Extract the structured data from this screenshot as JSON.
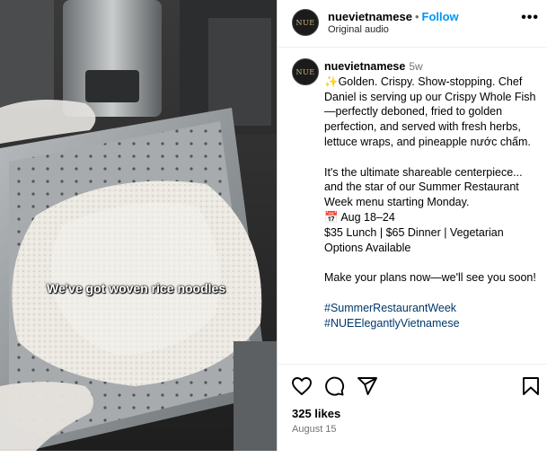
{
  "header": {
    "avatar_text": "NUE",
    "username": "nuevietnamese",
    "separator": "•",
    "follow_label": "Follow",
    "audio_label": "Original audio",
    "more_label": "•••"
  },
  "video": {
    "caption": "We've got woven rice noodles"
  },
  "post": {
    "author": "nuevietnamese",
    "time": "5w",
    "line1": "✨Golden. Crispy. Show-stopping. Chef Daniel is serving up our Crispy Whole Fish—perfectly deboned, fried to golden perfection, and served with fresh herbs, lettuce wraps, and pineapple nước chấm.",
    "line2": "It's the ultimate shareable centerpiece... and the star of our Summer Restaurant Week menu starting Monday.",
    "line3": "📅 Aug 18–24",
    "line4": "$35 Lunch | $65 Dinner | Vegetarian Options Available",
    "line5": "Make your plans now—we'll see you soon!",
    "hashtag1": "#SummerRestaurantWeek",
    "hashtag2": "#NUEElegantlyVietnamese"
  },
  "footer": {
    "likes": "325 likes",
    "date": "August 15"
  },
  "icons": [
    "heart-icon",
    "comment-icon",
    "share-icon",
    "bookmark-icon"
  ]
}
